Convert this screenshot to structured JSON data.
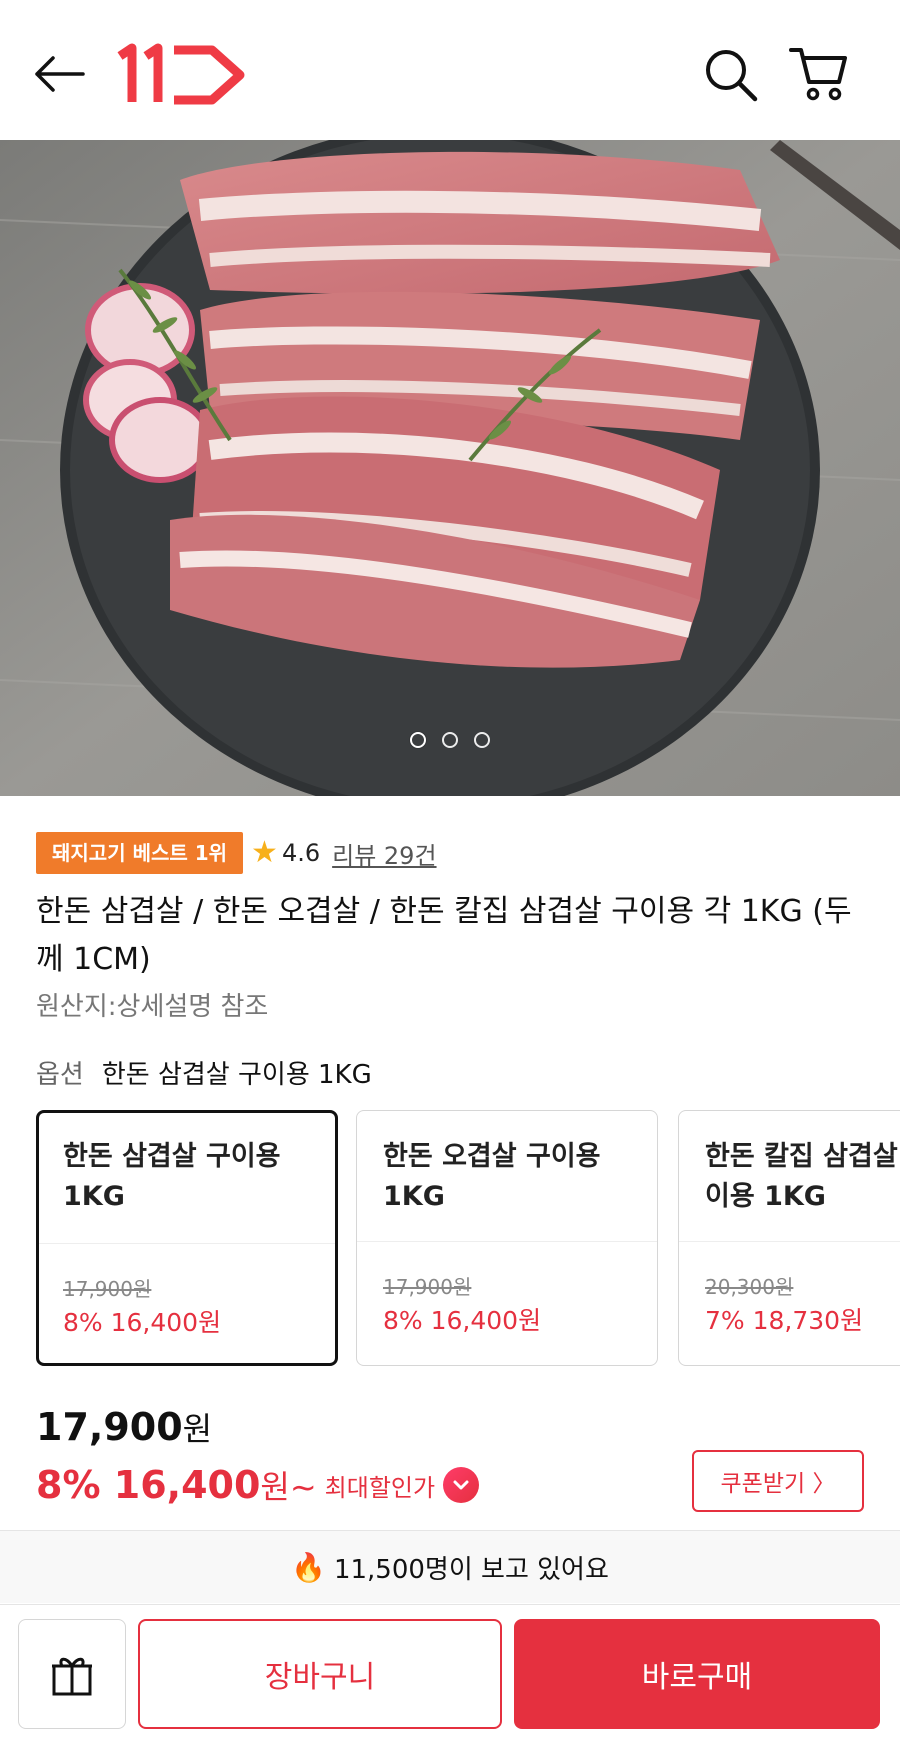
{
  "header": {
    "logo_text": "11"
  },
  "hero": {
    "slide_count": 3,
    "active_slide": 1
  },
  "product": {
    "best_badge": "돼지고기 베스트 1위",
    "rating": "4.6",
    "review_link": "리뷰 29건",
    "title": "한돈 삼겹살 / 한돈 오겹살 / 한돈 칼집 삼겹살  구이용 각 1KG (두께 1CM)",
    "origin": "원산지:상세설명 참조"
  },
  "option": {
    "label": "옵션",
    "selected_value": "한돈 삼겹살 구이용 1KG",
    "cards": [
      {
        "name_line1": "한돈 삼겹살 구이용",
        "name_line2": "1KG",
        "original_price": "17,900원",
        "sale": "8% 16,400원"
      },
      {
        "name_line1": "한돈 오겹살 구이용",
        "name_line2": "1KG",
        "original_price": "17,900원",
        "sale": "8% 16,400원"
      },
      {
        "name_line1": "한돈 칼집 삼겹살 구",
        "name_line2": "이용 1KG",
        "original_price": "20,300원",
        "sale": "7% 18,730원"
      }
    ]
  },
  "price": {
    "original_amount": "17,900",
    "original_unit": "원",
    "discount_pct": "8%",
    "sale_amount": "16,400",
    "sale_unit": "원~",
    "max_discount_label": "최대할인가",
    "coupon_button": "쿠폰받기 〉"
  },
  "viewers": {
    "text": "11,500명이 보고 있어요"
  },
  "bottom_bar": {
    "cart_button": "장바구니",
    "buy_button": "바로구매"
  },
  "colors": {
    "brand_red": "#e5303f",
    "badge_orange": "#f07b2a",
    "star": "#f7b01b"
  }
}
